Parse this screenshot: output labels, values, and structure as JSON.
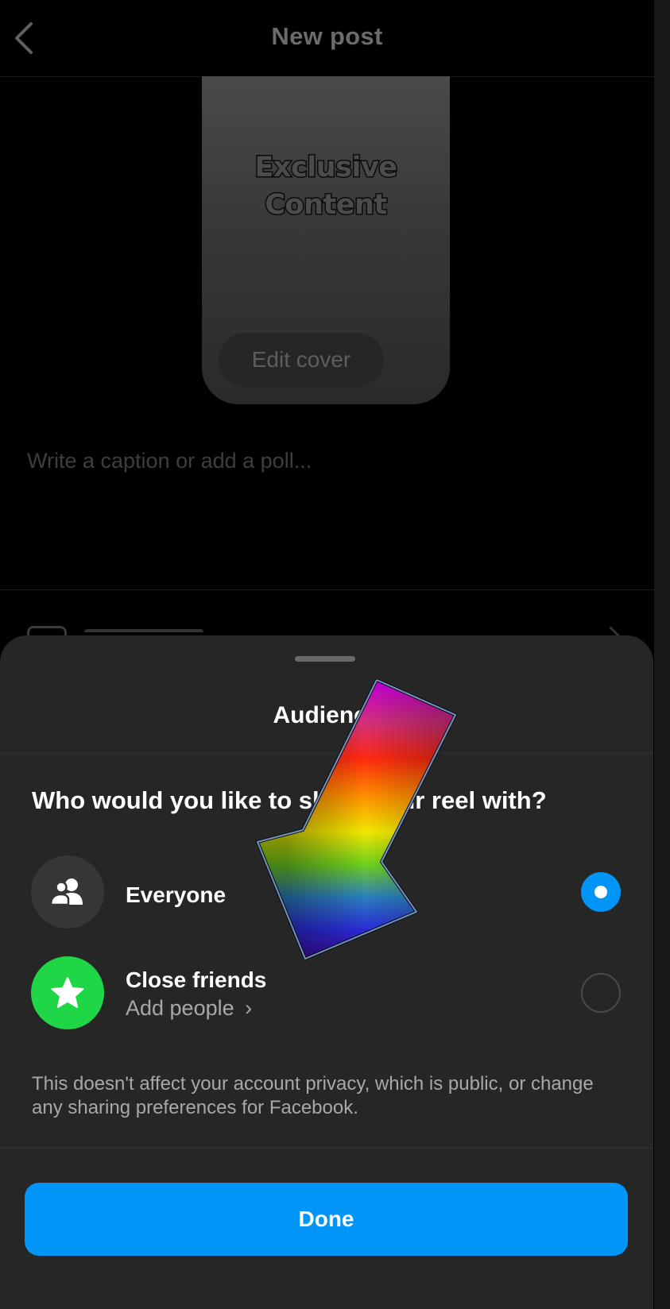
{
  "header": {
    "title": "New post",
    "back_icon": "chevron-left-icon"
  },
  "cover": {
    "overlay_text_line1": "Exclusive",
    "overlay_text_line2": "Content",
    "edit_cover_label": "Edit cover"
  },
  "caption": {
    "placeholder": "Write a caption or add a poll..."
  },
  "audience_sheet": {
    "title": "Audience",
    "question": "Who would you like to share your reel with?",
    "options": [
      {
        "label": "Everyone",
        "icon": "people-icon",
        "icon_bg": "#363636",
        "selected": true
      },
      {
        "label": "Close friends",
        "sublabel": "Add people",
        "sublabel_chevron": "›",
        "icon": "star-icon",
        "icon_bg": "#1fd646",
        "selected": false
      }
    ],
    "disclaimer": "This doesn't affect your account privacy, which is public, or change any sharing preferences for Facebook.",
    "done_label": "Done"
  },
  "colors": {
    "accent": "#0095f6",
    "sheet_bg": "#262626",
    "close_friends_green": "#1fd646"
  },
  "overlay": {
    "icon": "rainbow-arrow-down-left-icon"
  }
}
